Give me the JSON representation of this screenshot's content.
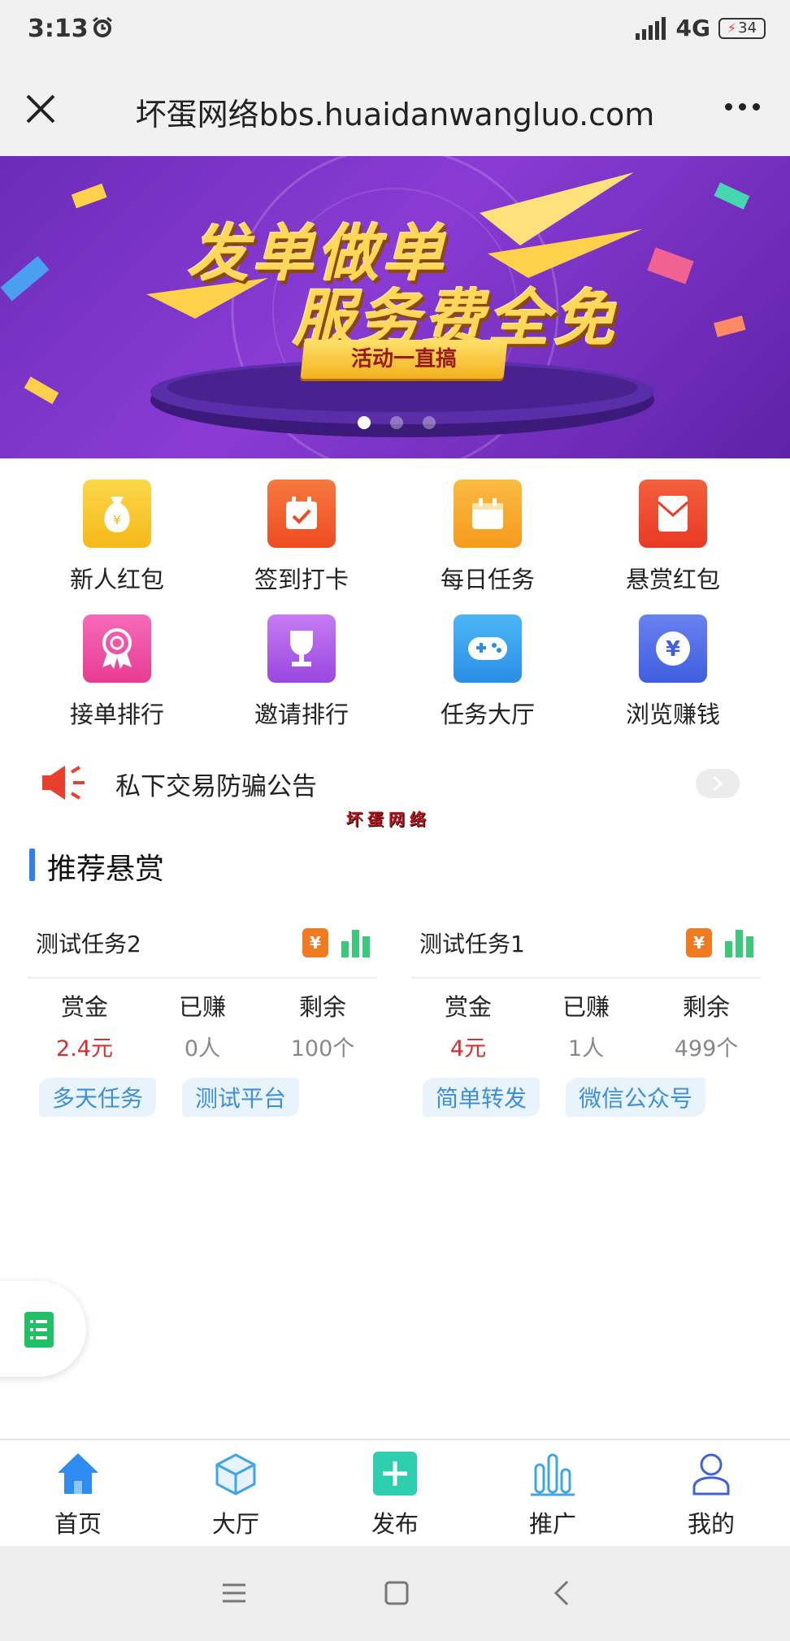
{
  "status_bar": {
    "time": "3:13",
    "network": "4G",
    "battery": "34"
  },
  "title_bar": {
    "title": "坏蛋网络bbs.huaidanwangluo.com"
  },
  "banner": {
    "line1": "发单做单",
    "line2": "服务费全免",
    "ribbon": "活动一直搞",
    "slide_count": 3,
    "active_slide": 0
  },
  "grid": [
    {
      "label": "新人红包",
      "icon": "money-bag-icon",
      "color": "#f9c623"
    },
    {
      "label": "签到打卡",
      "icon": "calendar-check-icon",
      "color": "#f2612f"
    },
    {
      "label": "每日任务",
      "icon": "calendar-icon",
      "color": "#f9a72a"
    },
    {
      "label": "悬赏红包",
      "icon": "red-envelope-icon",
      "color": "#f0442e"
    },
    {
      "label": "接单排行",
      "icon": "medal-icon",
      "color": "#ee4aa3"
    },
    {
      "label": "邀请排行",
      "icon": "trophy-icon",
      "color": "#a855e6"
    },
    {
      "label": "任务大厅",
      "icon": "gamepad-icon",
      "color": "#3aa4ee"
    },
    {
      "label": "浏览赚钱",
      "icon": "yen-coin-icon",
      "color": "#4f6ee8"
    }
  ],
  "notice": {
    "text": "私下交易防骗公告",
    "watermark": "坏蛋网络"
  },
  "section": {
    "title": "推荐悬赏"
  },
  "tasks": [
    {
      "title": "测试任务2",
      "stats": [
        {
          "label": "赏金",
          "value": "2.4元"
        },
        {
          "label": "已赚",
          "value": "0人"
        },
        {
          "label": "剩余",
          "value": "100个"
        }
      ],
      "tags": [
        "多天任务",
        "测试平台"
      ]
    },
    {
      "title": "测试任务1",
      "stats": [
        {
          "label": "赏金",
          "value": "4元"
        },
        {
          "label": "已赚",
          "value": "1人"
        },
        {
          "label": "剩余",
          "value": "499个"
        }
      ],
      "tags": [
        "简单转发",
        "微信公众号"
      ]
    }
  ],
  "tabbar": [
    {
      "label": "首页",
      "icon": "home-icon",
      "active": true
    },
    {
      "label": "大厅",
      "icon": "cube-icon",
      "active": false
    },
    {
      "label": "发布",
      "icon": "plus-icon",
      "active": false
    },
    {
      "label": "推广",
      "icon": "bar-chart-icon",
      "active": false
    },
    {
      "label": "我的",
      "icon": "user-icon",
      "active": false
    }
  ],
  "colors": {
    "accent_blue": "#2f80ed",
    "reward_red": "#d32f2f",
    "tag_text": "#3e8fd6",
    "tag_bg": "#e9f3fb"
  }
}
